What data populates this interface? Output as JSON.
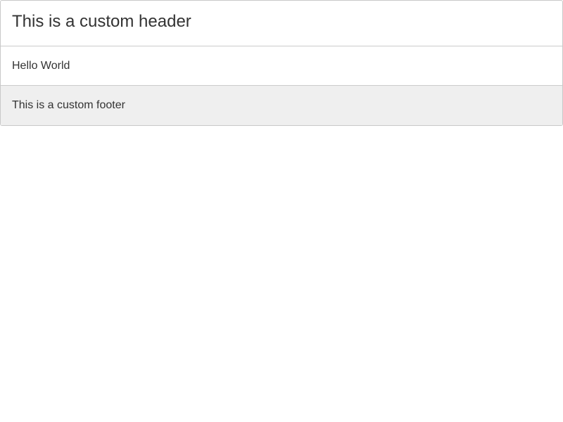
{
  "panel": {
    "header": "This is a custom header",
    "body": "Hello World",
    "footer": "This is a custom footer"
  }
}
